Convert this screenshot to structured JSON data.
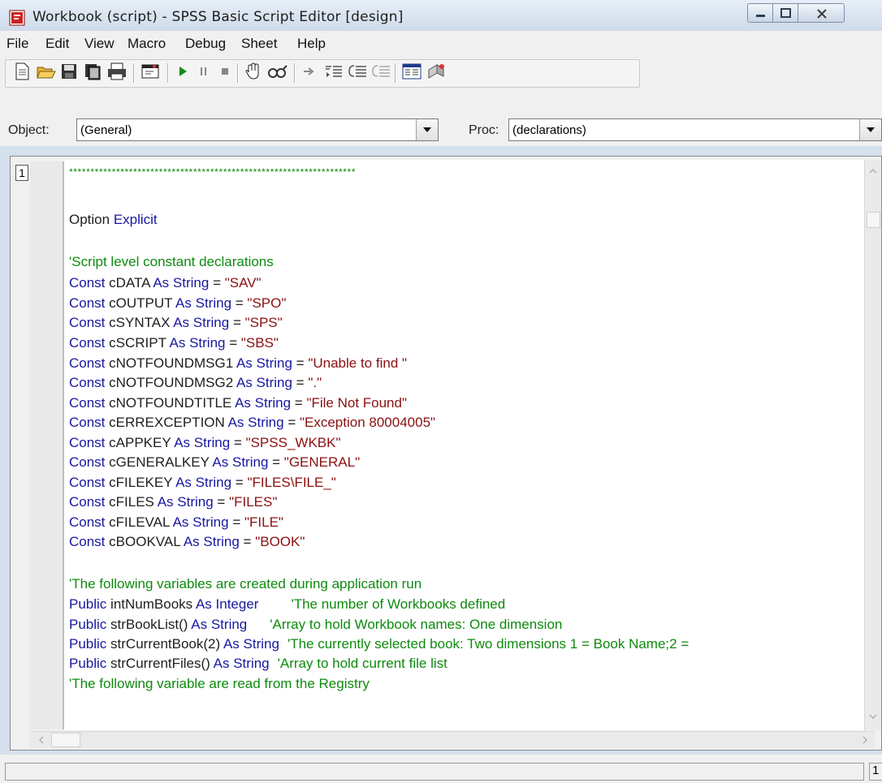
{
  "window": {
    "title": "Workbook (script) - SPSS Basic Script Editor [design]",
    "icons": [
      "app-icon",
      "minimize-icon",
      "maximize-icon",
      "close-icon"
    ]
  },
  "menu": [
    "File",
    "Edit",
    "View",
    "Macro",
    "Debug",
    "Sheet",
    "Help"
  ],
  "toolbar": {
    "buttons": [
      "new-icon",
      "open-icon",
      "save-icon",
      "copy-icon",
      "print-icon",
      "dialog-editor-icon",
      "run-icon",
      "pause-icon",
      "stop-icon",
      "hand-icon",
      "watch-icon",
      "step-arrow-icon",
      "step-into-icon",
      "step-over-icon",
      "step-out-icon",
      "properties-icon",
      "object-browser-icon"
    ]
  },
  "objectbar": {
    "object_label": "Object:",
    "object_value": "(General)",
    "proc_label": "Proc:",
    "proc_value": "(declarations)"
  },
  "editor": {
    "line_number": "1",
    "stars": "*******************************************************************",
    "lines": [
      {
        "t": "Option ",
        "kw": "Explicit"
      },
      {
        "cmt": "'Script level constant declarations"
      },
      {
        "name": "cDATA",
        "val": "\"SAV\""
      },
      {
        "name": "cOUTPUT",
        "val": "\"SPO\""
      },
      {
        "name": "cSYNTAX",
        "val": "\"SPS\""
      },
      {
        "name": "cSCRIPT",
        "val": "\"SBS\""
      },
      {
        "name": "cNOTFOUNDMSG1",
        "val": "\"Unable to find \""
      },
      {
        "name": "cNOTFOUNDMSG2",
        "val": "\".\""
      },
      {
        "name": "cNOTFOUNDTITLE",
        "val": "\"File Not Found\""
      },
      {
        "name": "cERREXCEPTION",
        "val": "\"Exception 80004005\""
      },
      {
        "name": "cAPPKEY",
        "val": "\"SPSS_WKBK\""
      },
      {
        "name": "cGENERALKEY",
        "val": "\"GENERAL\""
      },
      {
        "name": "cFILEKEY",
        "val": "\"FILES\\FILE_\""
      },
      {
        "name": "cFILES",
        "val": "\"FILES\""
      },
      {
        "name": "cFILEVAL",
        "val": "\"FILE\""
      },
      {
        "name": "cBOOKVAL",
        "val": "\"BOOK\""
      },
      {
        "cmt": "'The following variables are created during application run"
      },
      {
        "pub": "intNumBooks",
        "type": "Integer",
        "cmt": "'The number of Workbooks defined"
      },
      {
        "pub": "strBookList()",
        "type": "String",
        "cmt": "'Array to hold Workbook names: One dimension"
      },
      {
        "pub": "strCurrentBook(2)",
        "type": "String",
        "cmt": "'The currently selected book: Two dimensions 1 = Book Name;2 ="
      },
      {
        "pub": "strCurrentFiles()",
        "type": "String",
        "cmt": "'Array to hold current file list"
      },
      {
        "cmt": "'The following variable are read from the Registry"
      }
    ],
    "keywords": {
      "const": "Const",
      "as": "As",
      "string": "String",
      "public": "Public"
    }
  },
  "status": {
    "right_value": "1"
  },
  "colors": {
    "keyword": "#1818a0",
    "string": "#8b1010",
    "comment": "#0e8a0e"
  }
}
